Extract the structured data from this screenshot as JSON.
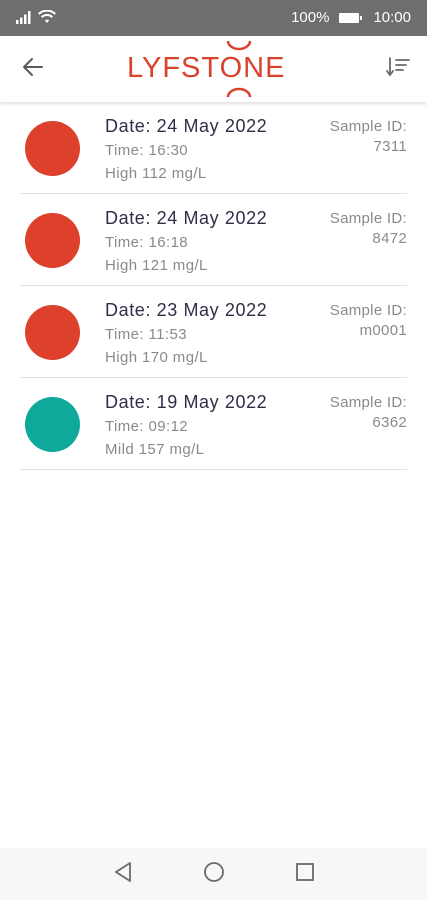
{
  "status_bar": {
    "signal_icon": "signal-icon",
    "wifi_icon": "wifi-icon",
    "battery": "100%",
    "battery_icon": "battery-icon",
    "time": "10:00"
  },
  "app_bar": {
    "back_icon": "arrow-left-icon",
    "logo_text": "LYFSTONE",
    "sort_icon": "sort-icon"
  },
  "colors": {
    "brand": "#d9432c",
    "high": "#dd412b",
    "mild": "#0fa99b"
  },
  "samples": [
    {
      "date": "Date: 24 May 2022",
      "time": "Time: 16:30",
      "reading": "High 112 mg/L",
      "sample_id_label": "Sample ID:",
      "sample_id": "7311",
      "status_color": "#dd412b"
    },
    {
      "date": "Date: 24 May 2022",
      "time": "Time: 16:18",
      "reading": "High 121 mg/L",
      "sample_id_label": "Sample ID:",
      "sample_id": "8472",
      "status_color": "#dd412b"
    },
    {
      "date": "Date: 23 May 2022",
      "time": "Time: 11:53",
      "reading": "High 170 mg/L",
      "sample_id_label": "Sample ID:",
      "sample_id": "m0001",
      "status_color": "#dd412b"
    },
    {
      "date": "Date: 19 May 2022",
      "time": "Time: 09:12",
      "reading": "Mild 157 mg/L",
      "sample_id_label": "Sample ID:",
      "sample_id": "6362",
      "status_color": "#0fa99b"
    }
  ],
  "nav_bar": {
    "back_icon": "triangle-back-icon",
    "home_icon": "circle-home-icon",
    "recents_icon": "square-recents-icon"
  }
}
